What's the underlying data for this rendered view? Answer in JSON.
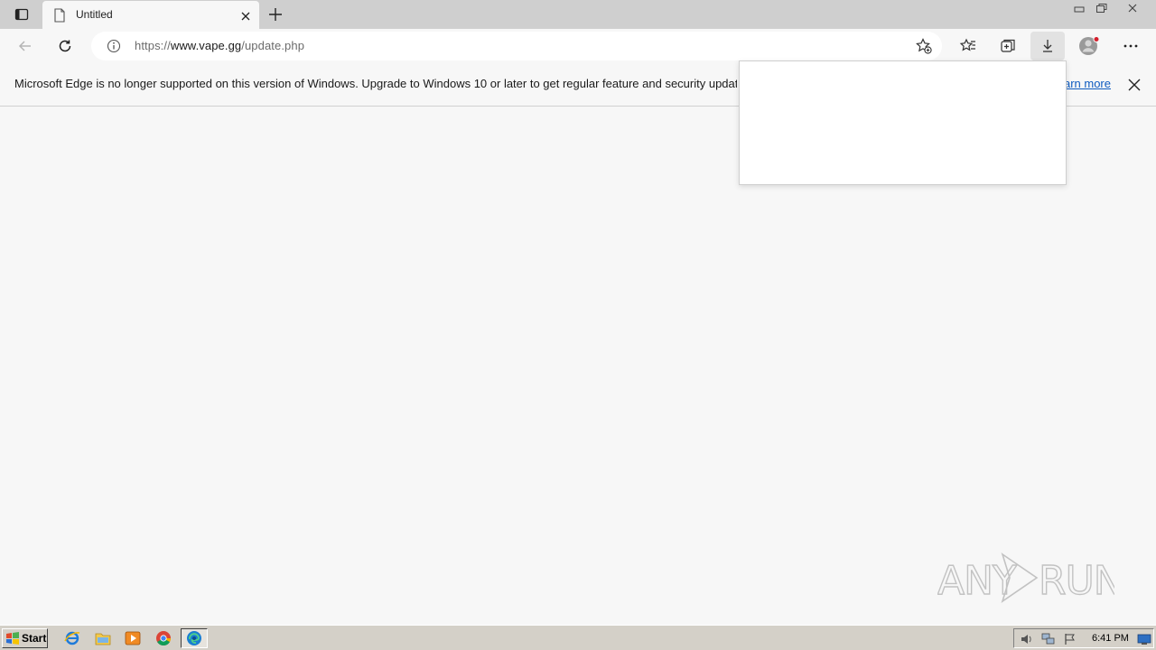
{
  "tab": {
    "title": "Untitled"
  },
  "address_bar": {
    "url_scheme": "https://",
    "url_host": "www.vape.gg",
    "url_path": "/update.php"
  },
  "infobar": {
    "message": "Microsoft Edge is no longer supported on this version of Windows. Upgrade to Windows 10 or later to get regular feature and security updates.",
    "link_label": "Learn more"
  },
  "taskbar": {
    "start_label": "Start",
    "clock": "6:41 PM"
  },
  "watermark": {
    "text_left": "ANY",
    "text_right": "RUN"
  },
  "colors": {
    "accent_link": "#0f5cc0",
    "profile_badge": "#d4212e",
    "edge_blue": "#1a7fd1"
  }
}
